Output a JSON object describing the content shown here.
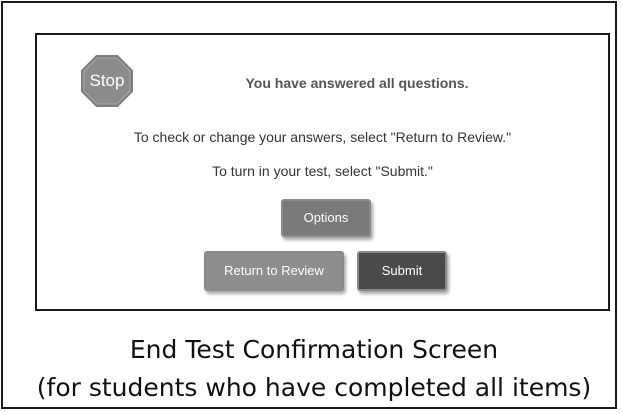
{
  "dialog": {
    "stop_icon_label": "Stop",
    "heading": "You have answered all questions.",
    "instruction_review": "To check or change your answers, select \"Return to Review.\"",
    "instruction_submit": "To turn in your test, select \"Submit.\"",
    "options_label": "Options",
    "return_label": "Return to Review",
    "submit_label": "Submit"
  },
  "caption": {
    "title": "End Test Confirmation Screen",
    "subtitle": "(for students who have completed all items)"
  },
  "colors": {
    "stop_sign": "#8c8c8c",
    "options_button": "#7a7a7a",
    "return_button": "#8e8e8e",
    "submit_button": "#4a4a4a"
  },
  "icons": {
    "stop": "stop-sign-icon"
  }
}
